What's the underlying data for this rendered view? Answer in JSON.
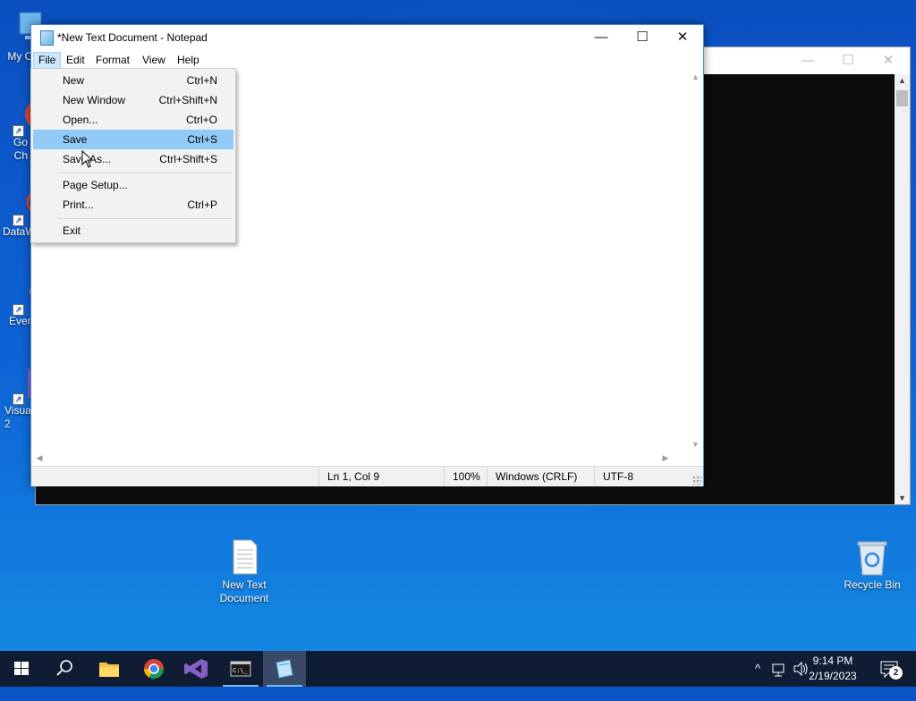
{
  "desktop": {
    "icons": [
      {
        "label": "My Co",
        "name": "my-computer"
      },
      {
        "label": "Go\nCh",
        "name": "google-chrome"
      },
      {
        "label": "DataW",
        "name": "datawrapper"
      },
      {
        "label": "Ever",
        "name": "everything"
      },
      {
        "label": "Visua\n2",
        "name": "visual-studio"
      },
      {
        "label": "New Text\nDocument",
        "name": "new-text-document"
      },
      {
        "label": "Recycle Bin",
        "name": "recycle-bin"
      }
    ]
  },
  "console": {
    "minimize_icon": "—",
    "maximize_icon": "☐",
    "close_icon": "✕"
  },
  "notepad": {
    "title": "*New Text Document - Notepad",
    "menu": [
      "File",
      "Edit",
      "Format",
      "View",
      "Help"
    ],
    "active_menu": "File",
    "status": {
      "position": "Ln 1, Col 9",
      "zoom": "100%",
      "line_ending": "Windows (CRLF)",
      "encoding": "UTF-8"
    }
  },
  "file_menu": {
    "items": [
      {
        "label": "New",
        "shortcut": "Ctrl+N"
      },
      {
        "label": "New Window",
        "shortcut": "Ctrl+Shift+N"
      },
      {
        "label": "Open...",
        "shortcut": "Ctrl+O"
      },
      {
        "label": "Save",
        "shortcut": "Ctrl+S"
      },
      {
        "label": "Save As...",
        "shortcut": "Ctrl+Shift+S"
      },
      {
        "label": "Page Setup...",
        "shortcut": ""
      },
      {
        "label": "Print...",
        "shortcut": "Ctrl+P"
      },
      {
        "label": "Exit",
        "shortcut": ""
      }
    ],
    "highlighted": "Save"
  },
  "taskbar": {
    "clock_time": "9:14 PM",
    "clock_date": "2/19/2023",
    "notification_count": "2",
    "pinned": [
      "start",
      "search",
      "file-explorer",
      "chrome",
      "visual-studio",
      "terminal",
      "notepad"
    ]
  },
  "colors": {
    "accent": "#0078d7",
    "menu_highlight": "#91c9f7",
    "taskbar": "#0f1c34"
  }
}
